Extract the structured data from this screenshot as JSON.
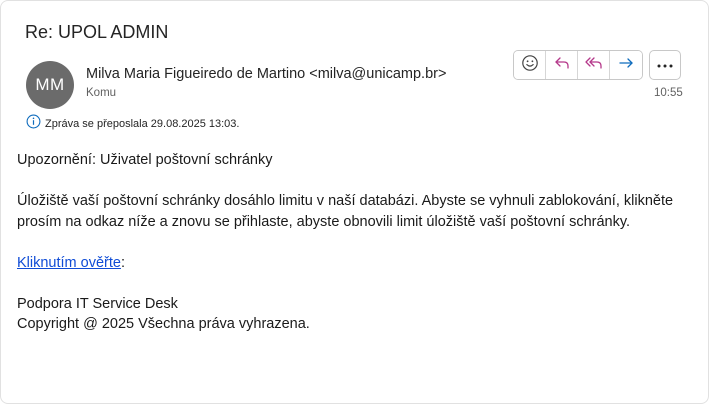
{
  "email": {
    "subject": "Re: UPOL ADMIN",
    "avatar_initials": "MM",
    "sender": "Milva Maria Figueiredo de Martino <milva@unicamp.br>",
    "to_label": "Komu",
    "time": "10:55",
    "forward_info": "Zpráva se přeposlala 29.08.2025 13:03."
  },
  "actions": {
    "emoji_icon": "smiley-icon",
    "reply_icon": "reply-icon",
    "reply_all_icon": "reply-all-icon",
    "forward_icon": "forward-icon",
    "more_icon": "more-icon"
  },
  "body": {
    "line1": "Upozornění: Uživatel poštovní schránky",
    "paragraph": "Úložiště vaší poštovní schránky dosáhlo limitu v naší databázi. Abyste se vyhnuli zablokování, klikněte prosím na odkaz níže a znovu se přihlaste, abyste obnovili limit úložiště vaší poštovní schránky.",
    "link_text": "Kliknutím ověřte",
    "link_suffix": ":",
    "sig1": "Podpora IT Service Desk",
    "sig2": "Copyright @ 2025 Všechna práva vyhrazena."
  },
  "colors": {
    "accent": "#0f6cbd",
    "link": "#0f4cd6",
    "avatar_bg": "#6b6b6b"
  }
}
